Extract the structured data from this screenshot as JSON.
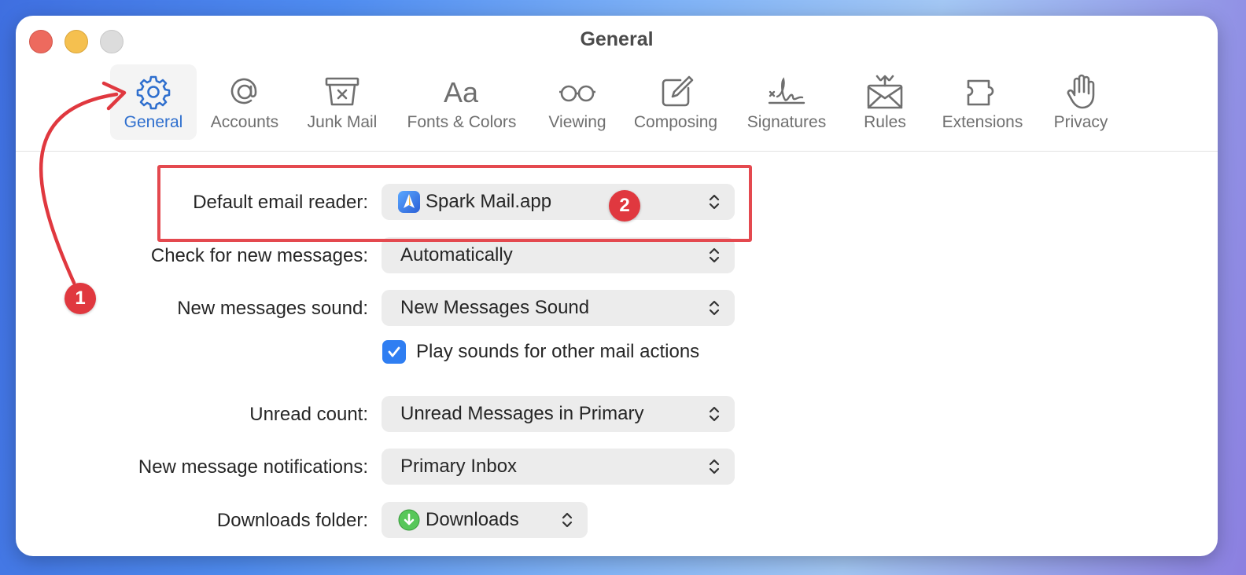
{
  "window": {
    "title": "General"
  },
  "toolbar": {
    "items": [
      {
        "label": "General",
        "icon": "gear-icon",
        "active": true
      },
      {
        "label": "Accounts",
        "icon": "at-sign-icon"
      },
      {
        "label": "Junk Mail",
        "icon": "junk-mail-icon"
      },
      {
        "label": "Fonts & Colors",
        "icon": "fonts-icon"
      },
      {
        "label": "Viewing",
        "icon": "glasses-icon"
      },
      {
        "label": "Composing",
        "icon": "compose-icon"
      },
      {
        "label": "Signatures",
        "icon": "signature-icon"
      },
      {
        "label": "Rules",
        "icon": "rules-envelope-icon"
      },
      {
        "label": "Extensions",
        "icon": "puzzle-icon"
      },
      {
        "label": "Privacy",
        "icon": "hand-icon"
      }
    ]
  },
  "settings": {
    "default_reader": {
      "label": "Default email reader:",
      "value": "Spark Mail.app",
      "icon": "spark-app-icon"
    },
    "check_messages": {
      "label": "Check for new messages:",
      "value": "Automatically"
    },
    "sound": {
      "label": "New messages sound:",
      "value": "New Messages Sound"
    },
    "play_sounds": {
      "label": "Play sounds for other mail actions",
      "checked": true
    },
    "unread_count": {
      "label": "Unread count:",
      "value": "Unread Messages in Primary"
    },
    "notifications": {
      "label": "New message notifications:",
      "value": "Primary Inbox"
    },
    "downloads": {
      "label": "Downloads folder:",
      "value": "Downloads",
      "icon": "downloads-folder-icon"
    }
  },
  "annotations": {
    "step1": "1",
    "step2": "2",
    "color": "#e0383f"
  },
  "colors": {
    "accent": "#2f6fce",
    "checkbox": "#2f7ef2"
  }
}
